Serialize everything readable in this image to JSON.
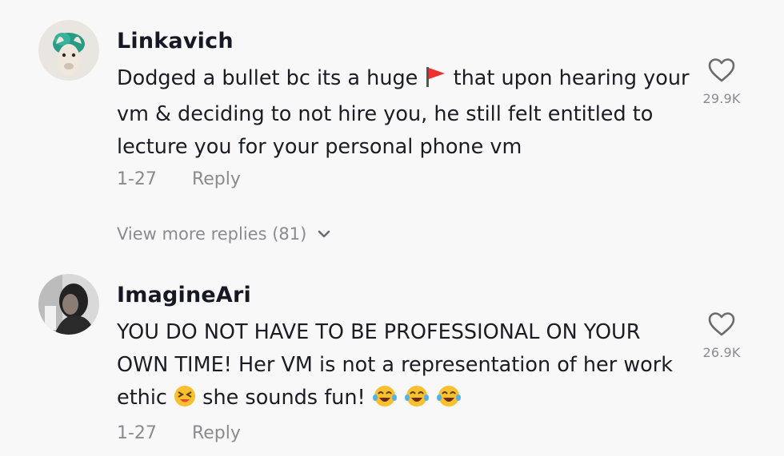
{
  "comments": [
    {
      "username": "Linkavich",
      "text_parts": [
        "Dodged a bullet bc its a huge ",
        "that upon hearing your vm & deciding to not hire you, he still felt entitled to lecture you for your personal phone vm"
      ],
      "date": "1-27",
      "reply_label": "Reply",
      "like_count": "29.9K",
      "icons": {
        "avatar": "llama-avatar",
        "emoji": "red-flag-icon",
        "like": "heart-icon"
      }
    },
    {
      "username": "ImagineAri",
      "text_parts": [
        "YOU DO NOT HAVE TO BE PROFESSIONAL ON YOUR OWN TIME! Her VM is not a representation of her work ethic ",
        " she sounds fun! "
      ],
      "date": "1-27",
      "reply_label": "Reply",
      "like_count": "26.9K",
      "icons": {
        "avatar": "person-avatar",
        "emojis": [
          "squinting-face-icon",
          "tears-of-joy-icon",
          "tears-of-joy-icon",
          "tears-of-joy-icon"
        ],
        "like": "heart-icon"
      }
    }
  ],
  "view_more_replies": "View more replies (81)"
}
